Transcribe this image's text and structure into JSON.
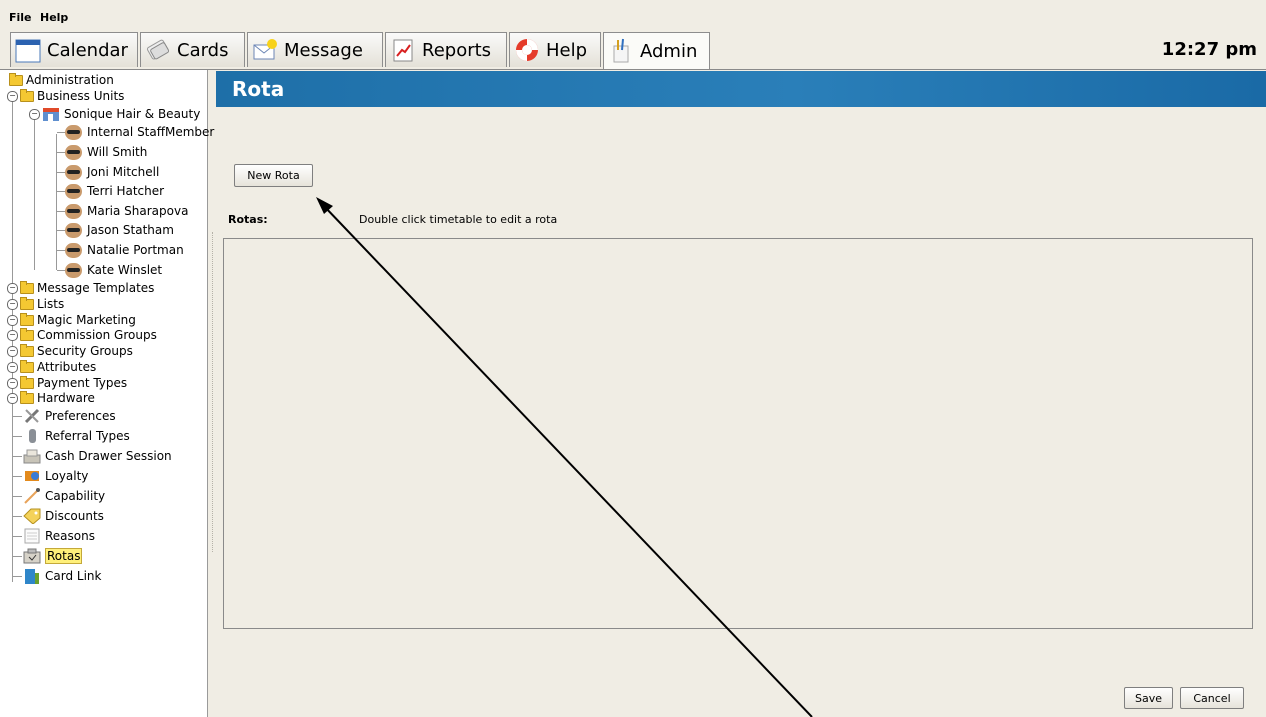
{
  "menu": [
    "File",
    "Help"
  ],
  "tabs": [
    {
      "label": "Calendar",
      "icon": "calendar-icon"
    },
    {
      "label": "Cards",
      "icon": "cards-icon"
    },
    {
      "label": "Message",
      "icon": "message-icon"
    },
    {
      "label": "Reports",
      "icon": "reports-icon"
    },
    {
      "label": "Help",
      "icon": "lifebuoy-icon"
    },
    {
      "label": "Admin",
      "icon": "admin-icon"
    }
  ],
  "clock": "12:27 pm",
  "tree": {
    "root": "Administration",
    "business_units": "Business Units",
    "business": "Sonique Hair & Beauty",
    "staff": [
      "Internal StaffMember",
      "Will Smith",
      "Joni Mitchell",
      "Terri Hatcher",
      "Maria Sharapova",
      "Jason Statham",
      "Natalie Portman",
      "Kate Winslet"
    ],
    "folders": [
      "Message Templates",
      "Lists",
      "Magic Marketing",
      "Commission Groups",
      "Security Groups",
      "Attributes",
      "Payment Types",
      "Hardware"
    ],
    "leaves": [
      {
        "label": "Preferences",
        "icon": "tools-icon"
      },
      {
        "label": "Referral Types",
        "icon": "referral-icon"
      },
      {
        "label": "Cash Drawer Session",
        "icon": "cash-drawer-icon"
      },
      {
        "label": "Loyalty",
        "icon": "loyalty-icon"
      },
      {
        "label": "Capability",
        "icon": "capability-icon"
      },
      {
        "label": "Discounts",
        "icon": "tag-icon"
      },
      {
        "label": "Reasons",
        "icon": "note-icon"
      },
      {
        "label": "Rotas",
        "icon": "rota-icon",
        "selected": true
      },
      {
        "label": "Card Link",
        "icon": "card-reader-icon"
      }
    ]
  },
  "panel": {
    "title": "Rota",
    "new_rota_label": "New Rota",
    "rotas_label": "Rotas:",
    "hint": "Double click timetable to edit a rota",
    "save_label": "Save",
    "cancel_label": "Cancel"
  },
  "colors": {
    "banner": "#1e6fa8",
    "background": "#f0ede4",
    "selection": "#fff07a"
  }
}
